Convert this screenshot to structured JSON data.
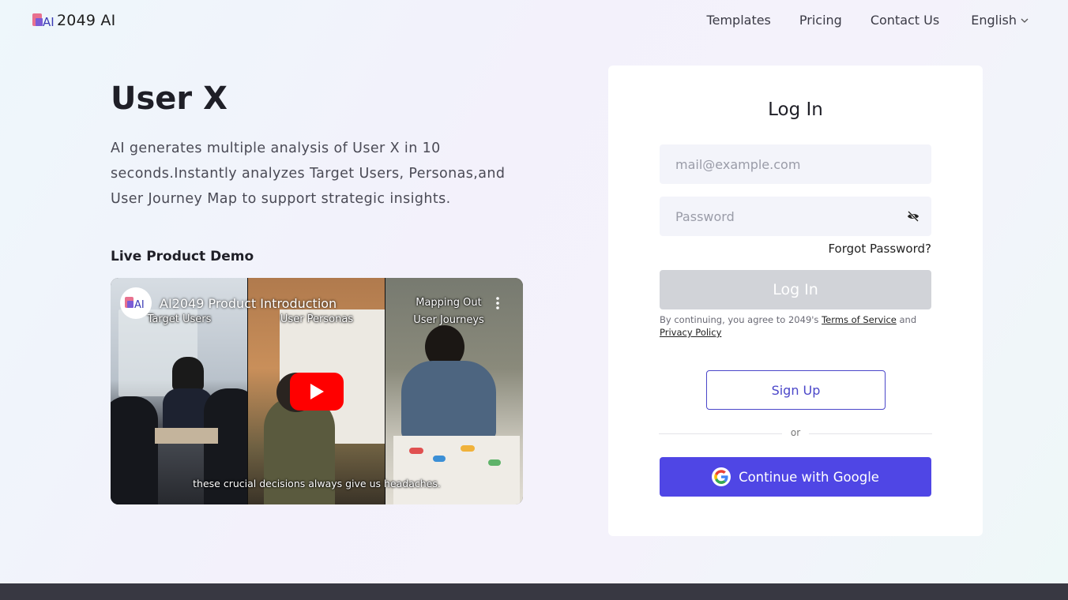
{
  "header": {
    "brand": "2049 AI",
    "nav": [
      "Templates",
      "Pricing",
      "Contact Us"
    ],
    "language": "English"
  },
  "hero": {
    "title": "User X",
    "description": "AI generates multiple analysis of User X in 10 seconds.Instantly analyzes Target Users, Personas,and User Journey Map to support strategic insights.",
    "demo_label": "Live Product Demo"
  },
  "video": {
    "title": "AI2049 Product Introduction",
    "captions": [
      "Target Users",
      "User Personas",
      "Mapping Out\nUser Journeys"
    ],
    "subtitle": "these crucial decisions always give us headaches."
  },
  "login": {
    "title": "Log In",
    "email_placeholder": "mail@example.com",
    "password_placeholder": "Password",
    "forgot": "Forgot Password?",
    "submit": "Log In",
    "terms_prefix": "By continuing, you agree to 2049's",
    "terms_link": "Terms of Service",
    "terms_and": "and",
    "privacy_link": "Privacy Policy",
    "signup": "Sign Up",
    "or": "or",
    "google": "Continue with Google"
  },
  "colors": {
    "accent": "#4f46e5",
    "disabled": "#d1d3d8",
    "footer": "#383842"
  }
}
